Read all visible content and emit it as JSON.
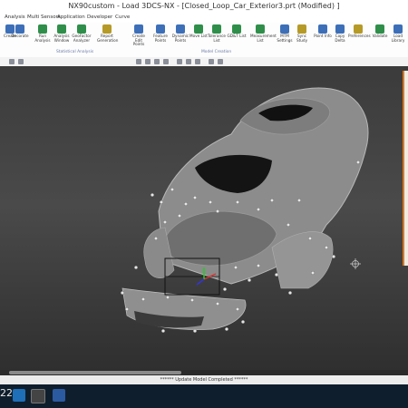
{
  "window": {
    "title": "NX90custom - Load 3DCS-NX - [Closed_Loop_Car_Exterior3.prt (Modified) ]"
  },
  "menu": [
    "Analysis",
    "Multi",
    "Sensors",
    "Application",
    "Developer",
    "Curve"
  ],
  "ribbon": {
    "buttons": [
      {
        "label": "Create",
        "color": "#3d6fb8"
      },
      {
        "label": "Decorate",
        "color": "#3d6fb8"
      },
      {
        "label": "Run Analysis",
        "color": "#2f8f4a"
      },
      {
        "label": "Analysis Window",
        "color": "#2f8f4a"
      },
      {
        "label": "GeoFactor Analyzer",
        "color": "#2f8f4a"
      },
      {
        "label": "Report Generation",
        "color": "#b59a28"
      },
      {
        "label": "Create Edit Points",
        "color": "#3d6fb8"
      },
      {
        "label": "Feature Points",
        "color": "#3d6fb8"
      },
      {
        "label": "Dynamic Points",
        "color": "#3d6fb8"
      },
      {
        "label": "Move List",
        "color": "#2f8f4a"
      },
      {
        "label": "Tolerance List",
        "color": "#2f8f4a"
      },
      {
        "label": "GD&T List",
        "color": "#2f8f4a"
      },
      {
        "label": "Measurement List",
        "color": "#2f8f4a"
      },
      {
        "label": "MTM Settings",
        "color": "#3d6fb8"
      },
      {
        "label": "Sync Study",
        "color": "#b59a28"
      },
      {
        "label": "Point Info",
        "color": "#3d6fb8"
      },
      {
        "label": "Copy Delta",
        "color": "#3d6fb8"
      },
      {
        "label": "Preferences",
        "color": "#b59a28"
      },
      {
        "label": "Validate",
        "color": "#2f8f4a"
      },
      {
        "label": "Load Library",
        "color": "#3d6fb8"
      }
    ],
    "groups": [
      "Statistical Analysis",
      "Model Creation"
    ]
  },
  "status": {
    "message": "****** Update Model Completed ******"
  },
  "taskbar": {
    "time": "22"
  }
}
